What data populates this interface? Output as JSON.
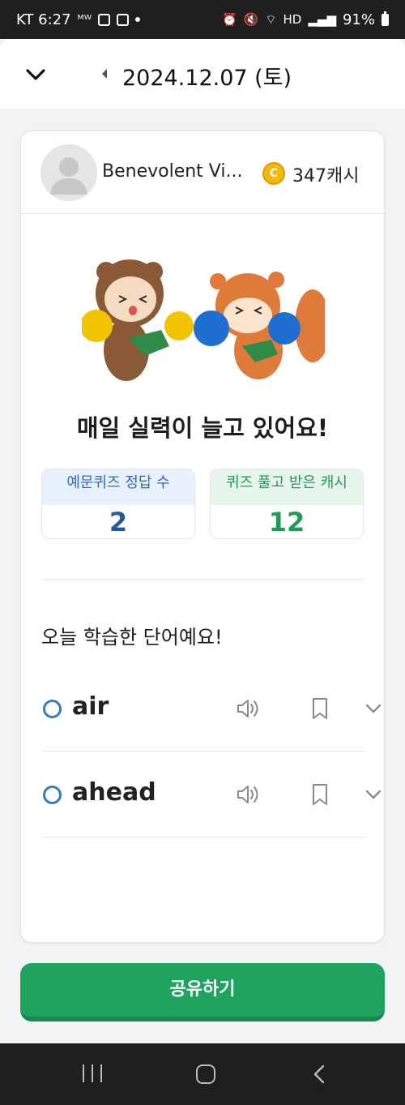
{
  "status_bar": {
    "carrier_time": "KT 6:27",
    "battery": "91%"
  },
  "header": {
    "date_title": "2024.12.07 (토)"
  },
  "profile": {
    "name": "Benevolent Vi...",
    "coin_symbol": "C",
    "cash": "347캐시"
  },
  "summary": {
    "headline": "매일 실력이 늘고 있어요!",
    "stats": [
      {
        "label": "예문퀴즈 정답 수",
        "value": "2"
      },
      {
        "label": "퀴즈 풀고 받은 캐시",
        "value": "12"
      }
    ]
  },
  "words_section": {
    "title": "오늘 학습한 단어예요!",
    "items": [
      {
        "word": "air"
      },
      {
        "word": "ahead"
      }
    ]
  },
  "share_button": {
    "label": "공유하기"
  },
  "colors": {
    "accent_green": "#1fa460",
    "accent_blue": "#2f7dc8",
    "coin": "#f5b700"
  }
}
